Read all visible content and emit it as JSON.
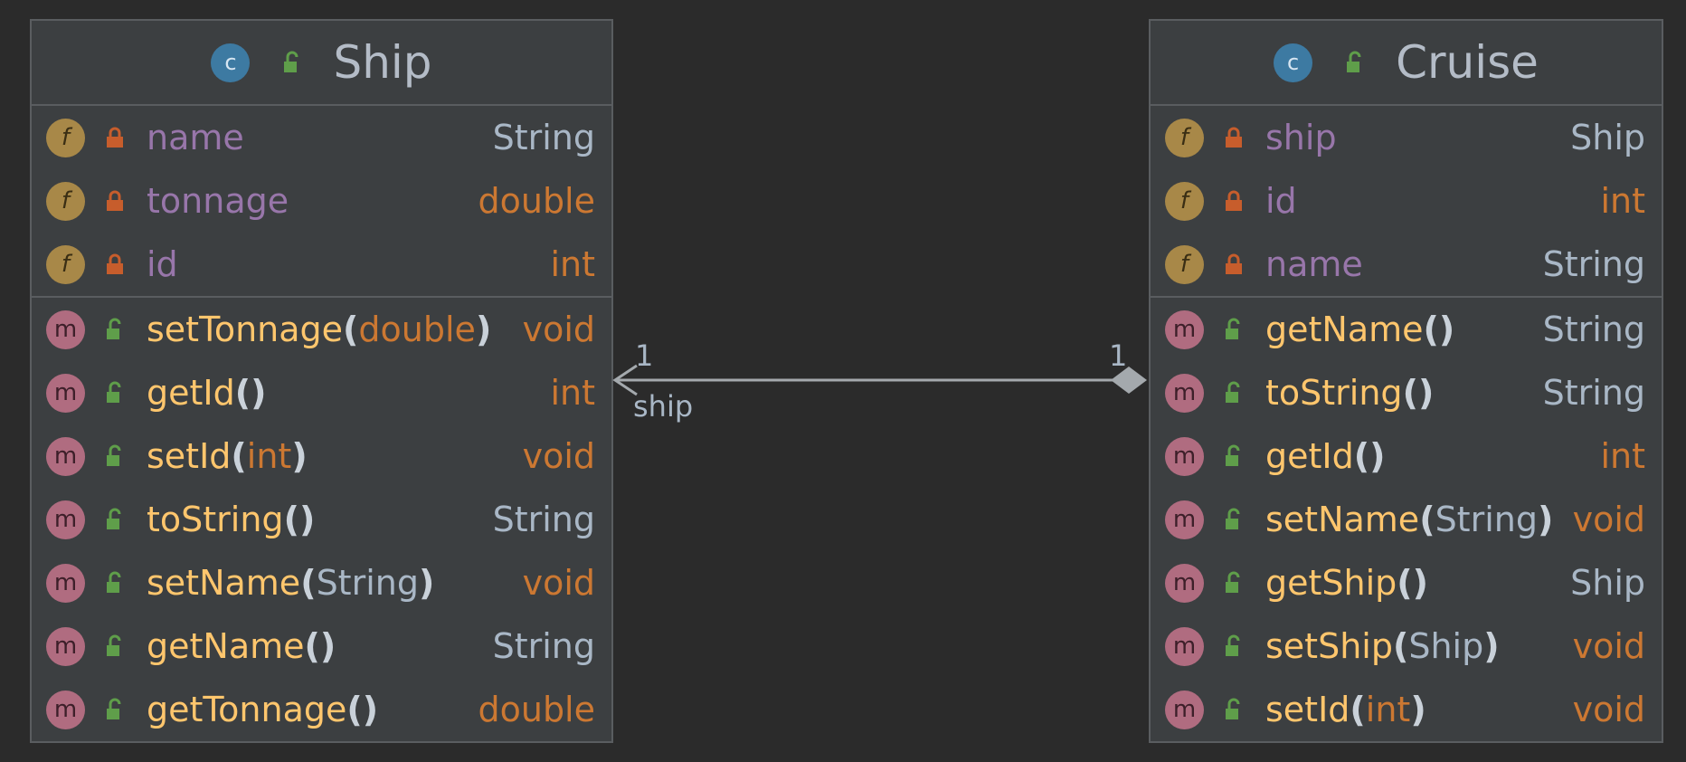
{
  "colors": {
    "background": "#2b2b2b",
    "box": "#3c3f41",
    "border": "#5a5d60",
    "field_name": "#9876aa",
    "method_name": "#ffc66d",
    "primitive_type": "#cc7832",
    "reference_type": "#a9b7c6",
    "class_icon": "#3d7aa2",
    "field_icon": "#a88848",
    "method_icon": "#b06c80",
    "private_lock": "#c75d2c",
    "public_lock": "#5f9e4a"
  },
  "classes": [
    {
      "id": "ship",
      "icon": "c",
      "title": "Ship",
      "fields": [
        {
          "icon": "f",
          "name": "name",
          "type": "String"
        },
        {
          "icon": "f",
          "name": "tonnage",
          "type": "double"
        },
        {
          "icon": "f",
          "name": "id",
          "type": "int"
        }
      ],
      "methods": [
        {
          "icon": "m",
          "name": "setTonnage",
          "param": "double",
          "type": "void"
        },
        {
          "icon": "m",
          "name": "getId",
          "param": "",
          "type": "int"
        },
        {
          "icon": "m",
          "name": "setId",
          "param": "int",
          "type": "void"
        },
        {
          "icon": "m",
          "name": "toString",
          "param": "",
          "type": "String"
        },
        {
          "icon": "m",
          "name": "setName",
          "param": "String",
          "type": "void"
        },
        {
          "icon": "m",
          "name": "getName",
          "param": "",
          "type": "String"
        },
        {
          "icon": "m",
          "name": "getTonnage",
          "param": "",
          "type": "double"
        }
      ]
    },
    {
      "id": "cruise",
      "icon": "c",
      "title": "Cruise",
      "fields": [
        {
          "icon": "f",
          "name": "ship",
          "type": "Ship"
        },
        {
          "icon": "f",
          "name": "id",
          "type": "int"
        },
        {
          "icon": "f",
          "name": "name",
          "type": "String"
        }
      ],
      "methods": [
        {
          "icon": "m",
          "name": "getName",
          "param": "",
          "type": "String"
        },
        {
          "icon": "m",
          "name": "toString",
          "param": "",
          "type": "String"
        },
        {
          "icon": "m",
          "name": "getId",
          "param": "",
          "type": "int"
        },
        {
          "icon": "m",
          "name": "setName",
          "param": "String",
          "type": "void"
        },
        {
          "icon": "m",
          "name": "getShip",
          "param": "",
          "type": "Ship"
        },
        {
          "icon": "m",
          "name": "setShip",
          "param": "Ship",
          "type": "void"
        },
        {
          "icon": "m",
          "name": "setId",
          "param": "int",
          "type": "void"
        }
      ]
    }
  ],
  "association": {
    "from_multiplicity": "1",
    "to_multiplicity": "1",
    "role": "ship"
  }
}
